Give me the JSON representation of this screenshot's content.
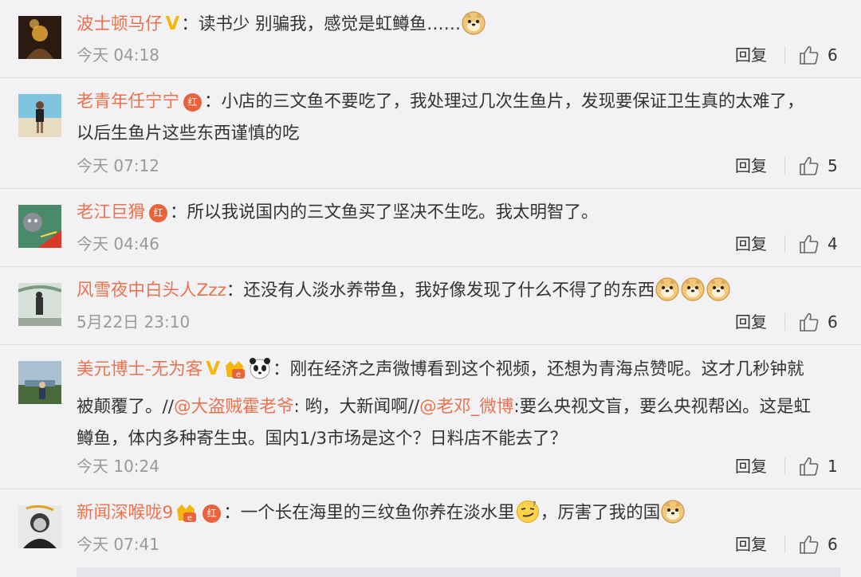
{
  "comments": [
    {
      "username": "波士顿马仔",
      "badges": [
        "verified-v"
      ],
      "text": "读书少 别骗我，感觉是虹鳟鱼……",
      "emojis_after": [
        "doge-emoji"
      ],
      "time": "今天 04:18",
      "reply": "回复",
      "likes": "6"
    },
    {
      "username": "老青年任宁宁",
      "badges": [
        "red-badge"
      ],
      "text_line1": "小店的三文鱼不要吃了，我处理过几次生鱼片，发现要保证卫生真的太难了，",
      "text_line2": "以后生鱼片这些东西谨慎的吃",
      "time": "今天 07:12",
      "reply": "回复",
      "likes": "5"
    },
    {
      "username": "老江巨猾",
      "badges": [
        "red-badge"
      ],
      "text": "所以我说国内的三文鱼买了坚决不生吃。我太明智了。",
      "time": "今天 04:46",
      "reply": "回复",
      "likes": "4"
    },
    {
      "username": "风雪夜中白头人Zzz",
      "text": "还没有人淡水养带鱼，我好像发现了什么不得了的东西",
      "emojis_after": [
        "doge-emoji",
        "doge-emoji",
        "doge-emoji"
      ],
      "time": "5月22日 23:10",
      "reply": "回复",
      "likes": "6"
    },
    {
      "username": "美元博士-无为客",
      "badges": [
        "verified-v",
        "vip-badge",
        "panda-emoji"
      ],
      "text_a": "刚在经济之声微博看到这个视频，还想为青海点赞呢。这才几秒钟就",
      "text_b": "被颠覆了。//",
      "mention_1": "@大盗贼霍老爷",
      "text_c": ": 哟，大新闻啊//",
      "mention_2": "@老邓_微博",
      "text_d": ":要么央视文盲，要么央视帮凶。这是虹",
      "text_e": "鳟鱼，体内多种寄生虫。国内1/3市场是这个？日料店不能去了？",
      "time": "今天 10:24",
      "reply": "回复",
      "likes": "1"
    },
    {
      "username": "新闻深喉咙9",
      "badges": [
        "vip-badge",
        "red-badge"
      ],
      "text_a": "一个长在海里的三纹鱼你养在淡水里",
      "text_b": "，厉害了我的国",
      "time": "今天 07:41",
      "reply": "回复",
      "likes": "6"
    }
  ],
  "badge_text": {
    "red": "红",
    "v": "V"
  },
  "colors": {
    "username": "#eb7350",
    "background": "#f2f2f5",
    "separator": "#dcdcdf",
    "time": "#999999"
  }
}
